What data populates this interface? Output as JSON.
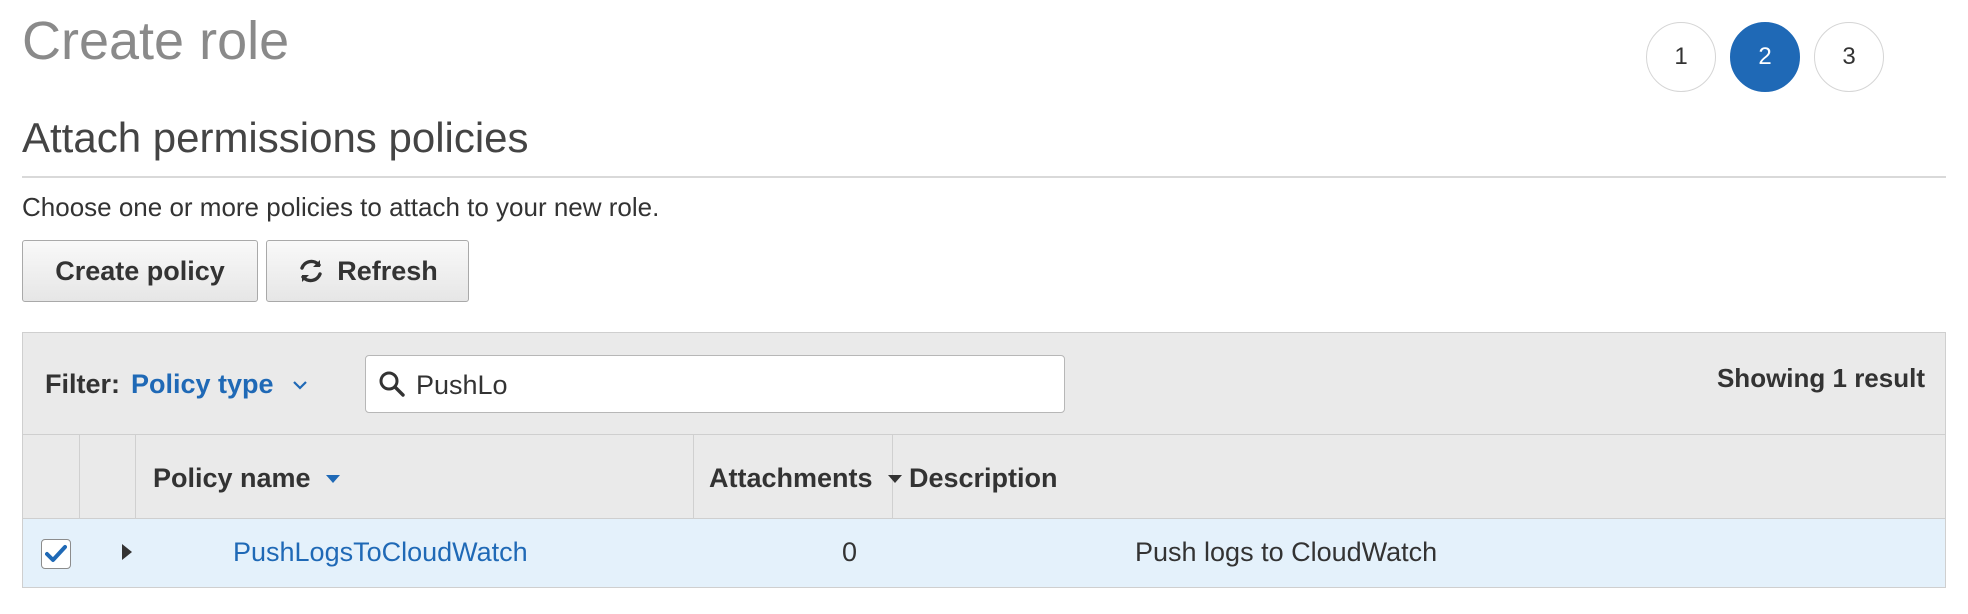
{
  "page": {
    "title": "Create role"
  },
  "steps": [
    {
      "label": "1",
      "active": false
    },
    {
      "label": "2",
      "active": true
    },
    {
      "label": "3",
      "active": false
    }
  ],
  "section": {
    "title": "Attach permissions policies",
    "intro": "Choose one or more policies to attach to your new role."
  },
  "toolbar": {
    "create_policy_label": "Create policy",
    "refresh_label": "Refresh",
    "refresh_icon": "refresh-icon"
  },
  "filter": {
    "label": "Filter:",
    "type_label": "Policy type",
    "type_icon": "chevron-down-icon",
    "search_value": "PushLo",
    "search_icon": "search-icon",
    "result_count": "Showing 1 result"
  },
  "table": {
    "columns": [
      {
        "label": "Policy name",
        "sort_icon": "caret-down-icon"
      },
      {
        "label": "Attachments",
        "sort_icon": "caret-down-icon"
      },
      {
        "label": "Description"
      }
    ],
    "rows": [
      {
        "checked": true,
        "name": "PushLogsToCloudWatch",
        "attachments": "0",
        "description": "Push logs to CloudWatch"
      }
    ]
  },
  "colors": {
    "accent": "#1f69b6",
    "title_gray": "#8a8a8a",
    "header_bg": "#eaeaea",
    "selected_row_bg": "#e4f1fb"
  }
}
